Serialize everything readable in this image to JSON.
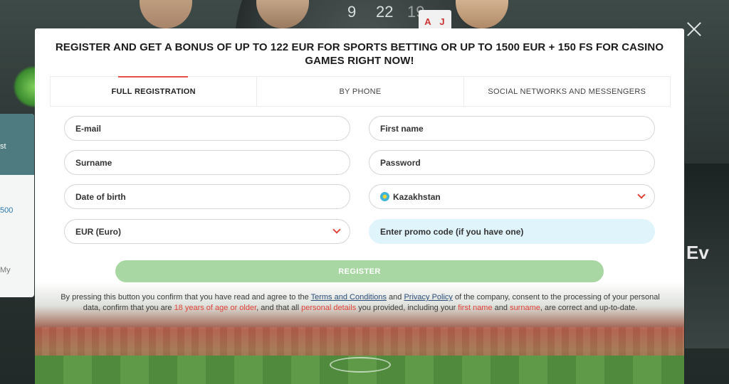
{
  "background": {
    "roulette_numbers": [
      "9",
      "22",
      "19"
    ],
    "cards": [
      "A",
      "J"
    ],
    "side_panel": {
      "top_text": "st",
      "link_text": "500",
      "bottom_text": "My"
    },
    "brand_fragment": "Ev"
  },
  "modal": {
    "title": "REGISTER AND GET A BONUS OF UP TO 122 EUR FOR SPORTS BETTING OR UP TO 1500 EUR + 150 FS FOR CASINO GAMES RIGHT NOW!",
    "tabs": [
      {
        "label": "FULL REGISTRATION",
        "active": true
      },
      {
        "label": "BY PHONE",
        "active": false
      },
      {
        "label": "SOCIAL NETWORKS AND MESSENGERS",
        "active": false
      }
    ],
    "fields": {
      "email": "E-mail",
      "first_name": "First name",
      "surname": "Surname",
      "password": "Password",
      "date_of_birth": "Date of birth",
      "country": "Kazakhstan",
      "currency": "EUR (Euro)",
      "promo_code": "Enter promo code (if you have one)"
    },
    "register_label": "REGISTER",
    "legal": {
      "p1": "By pressing this button you confirm that you have read and agree to the ",
      "terms": "Terms and Conditions",
      "p2": " and ",
      "privacy": "Privacy Policy",
      "p3": " of the company, consent to the processing of your personal data, confirm that you are ",
      "age": "18 years of age or older",
      "p4": ", and that all ",
      "personal": "personal details",
      "p5": " you provided, including your ",
      "first_name": "first name",
      "p6": " and ",
      "surname": "surname",
      "p7": ", are correct and up-to-date."
    }
  },
  "colors": {
    "accent_red": "#e5524a",
    "register_green": "#a9d7a4",
    "promo_bg": "#dff5fb",
    "link_blue": "#2c4e7a"
  }
}
